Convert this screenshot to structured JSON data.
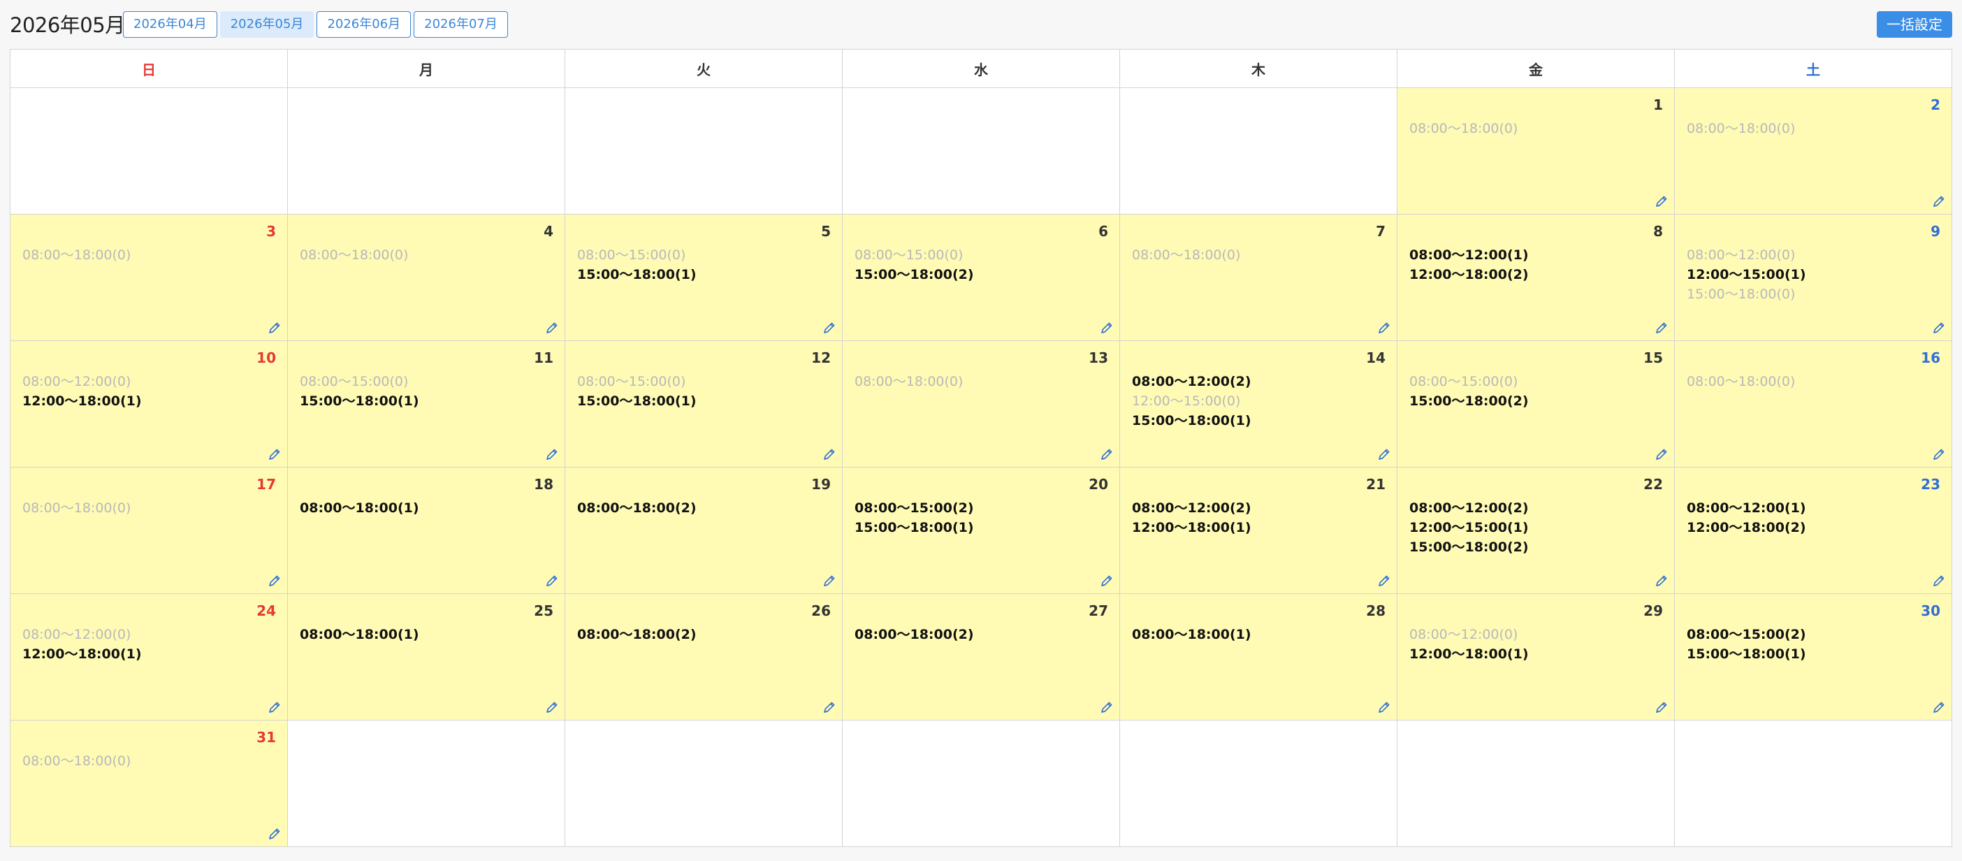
{
  "title": "2026年05月",
  "month_tabs": [
    {
      "label": "2026年04月",
      "active": false
    },
    {
      "label": "2026年05月",
      "active": true
    },
    {
      "label": "2026年06月",
      "active": false
    },
    {
      "label": "2026年07月",
      "active": false
    }
  ],
  "bulk_button": "一括設定",
  "weekdays": [
    "日",
    "月",
    "火",
    "水",
    "木",
    "金",
    "土"
  ],
  "icons": {
    "edit": "pencil-icon"
  },
  "colors": {
    "cell_filled": "#fffbb5",
    "sunday": "#e53935",
    "saturday": "#2f6fd6",
    "accent": "#3a8ee6",
    "slot_inactive": "#b8b8b8"
  },
  "weeks": [
    [
      null,
      null,
      null,
      null,
      null,
      {
        "day": 1,
        "slots": [
          {
            "text": "08:00〜18:00(0)",
            "active": false
          }
        ]
      },
      {
        "day": 2,
        "slots": [
          {
            "text": "08:00〜18:00(0)",
            "active": false
          }
        ]
      }
    ],
    [
      {
        "day": 3,
        "slots": [
          {
            "text": "08:00〜18:00(0)",
            "active": false
          }
        ]
      },
      {
        "day": 4,
        "slots": [
          {
            "text": "08:00〜18:00(0)",
            "active": false
          }
        ]
      },
      {
        "day": 5,
        "slots": [
          {
            "text": "08:00〜15:00(0)",
            "active": false
          },
          {
            "text": "15:00〜18:00(1)",
            "active": true
          }
        ]
      },
      {
        "day": 6,
        "slots": [
          {
            "text": "08:00〜15:00(0)",
            "active": false
          },
          {
            "text": "15:00〜18:00(2)",
            "active": true
          }
        ]
      },
      {
        "day": 7,
        "slots": [
          {
            "text": "08:00〜18:00(0)",
            "active": false
          }
        ]
      },
      {
        "day": 8,
        "slots": [
          {
            "text": "08:00〜12:00(1)",
            "active": true
          },
          {
            "text": "12:00〜18:00(2)",
            "active": true
          }
        ]
      },
      {
        "day": 9,
        "slots": [
          {
            "text": "08:00〜12:00(0)",
            "active": false
          },
          {
            "text": "12:00〜15:00(1)",
            "active": true
          },
          {
            "text": "15:00〜18:00(0)",
            "active": false
          }
        ]
      }
    ],
    [
      {
        "day": 10,
        "slots": [
          {
            "text": "08:00〜12:00(0)",
            "active": false
          },
          {
            "text": "12:00〜18:00(1)",
            "active": true
          }
        ]
      },
      {
        "day": 11,
        "slots": [
          {
            "text": "08:00〜15:00(0)",
            "active": false
          },
          {
            "text": "15:00〜18:00(1)",
            "active": true
          }
        ]
      },
      {
        "day": 12,
        "slots": [
          {
            "text": "08:00〜15:00(0)",
            "active": false
          },
          {
            "text": "15:00〜18:00(1)",
            "active": true
          }
        ]
      },
      {
        "day": 13,
        "slots": [
          {
            "text": "08:00〜18:00(0)",
            "active": false
          }
        ]
      },
      {
        "day": 14,
        "slots": [
          {
            "text": "08:00〜12:00(2)",
            "active": true
          },
          {
            "text": "12:00〜15:00(0)",
            "active": false
          },
          {
            "text": "15:00〜18:00(1)",
            "active": true
          }
        ]
      },
      {
        "day": 15,
        "slots": [
          {
            "text": "08:00〜15:00(0)",
            "active": false
          },
          {
            "text": "15:00〜18:00(2)",
            "active": true
          }
        ]
      },
      {
        "day": 16,
        "slots": [
          {
            "text": "08:00〜18:00(0)",
            "active": false
          }
        ]
      }
    ],
    [
      {
        "day": 17,
        "slots": [
          {
            "text": "08:00〜18:00(0)",
            "active": false
          }
        ]
      },
      {
        "day": 18,
        "slots": [
          {
            "text": "08:00〜18:00(1)",
            "active": true
          }
        ]
      },
      {
        "day": 19,
        "slots": [
          {
            "text": "08:00〜18:00(2)",
            "active": true
          }
        ]
      },
      {
        "day": 20,
        "slots": [
          {
            "text": "08:00〜15:00(2)",
            "active": true
          },
          {
            "text": "15:00〜18:00(1)",
            "active": true
          }
        ]
      },
      {
        "day": 21,
        "slots": [
          {
            "text": "08:00〜12:00(2)",
            "active": true
          },
          {
            "text": "12:00〜18:00(1)",
            "active": true
          }
        ]
      },
      {
        "day": 22,
        "slots": [
          {
            "text": "08:00〜12:00(2)",
            "active": true
          },
          {
            "text": "12:00〜15:00(1)",
            "active": true
          },
          {
            "text": "15:00〜18:00(2)",
            "active": true
          }
        ]
      },
      {
        "day": 23,
        "slots": [
          {
            "text": "08:00〜12:00(1)",
            "active": true
          },
          {
            "text": "12:00〜18:00(2)",
            "active": true
          }
        ]
      }
    ],
    [
      {
        "day": 24,
        "slots": [
          {
            "text": "08:00〜12:00(0)",
            "active": false
          },
          {
            "text": "12:00〜18:00(1)",
            "active": true
          }
        ]
      },
      {
        "day": 25,
        "slots": [
          {
            "text": "08:00〜18:00(1)",
            "active": true
          }
        ]
      },
      {
        "day": 26,
        "slots": [
          {
            "text": "08:00〜18:00(2)",
            "active": true
          }
        ]
      },
      {
        "day": 27,
        "slots": [
          {
            "text": "08:00〜18:00(2)",
            "active": true
          }
        ]
      },
      {
        "day": 28,
        "slots": [
          {
            "text": "08:00〜18:00(1)",
            "active": true
          }
        ]
      },
      {
        "day": 29,
        "slots": [
          {
            "text": "08:00〜12:00(0)",
            "active": false
          },
          {
            "text": "12:00〜18:00(1)",
            "active": true
          }
        ]
      },
      {
        "day": 30,
        "slots": [
          {
            "text": "08:00〜15:00(2)",
            "active": true
          },
          {
            "text": "15:00〜18:00(1)",
            "active": true
          }
        ]
      }
    ],
    [
      {
        "day": 31,
        "slots": [
          {
            "text": "08:00〜18:00(0)",
            "active": false
          }
        ]
      },
      null,
      null,
      null,
      null,
      null,
      null
    ]
  ]
}
